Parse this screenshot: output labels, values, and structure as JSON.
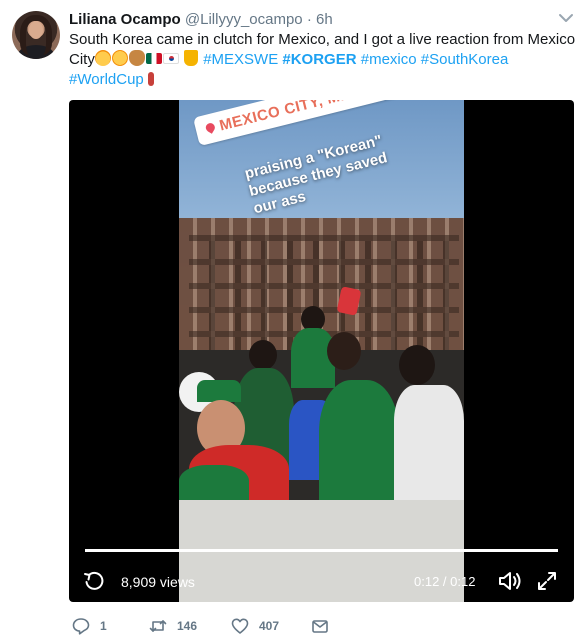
{
  "author": {
    "name": "Liliana Ocampo",
    "handle": "@Lillyyy_ocampo",
    "separator": "·",
    "time": "6h"
  },
  "tweet": {
    "line1": "South Korea came in clutch for Mexico, and I got a live reaction from Mexico",
    "line2_prefix": "City",
    "emojis": [
      "loudly-crying-face",
      "tears-of-joy-face",
      "clapping-hands",
      "mexico-flag",
      "south-korea-flag",
      "trophy"
    ],
    "hashtags_line2": [
      "#MEXSWE",
      "#KORGER",
      "#mexico",
      "#SouthKorea"
    ],
    "hashtags_line3": [
      "#WorldCup"
    ],
    "line3_emoji": "microphone"
  },
  "video": {
    "location_sticker": "MEXICO CITY, MEXICO",
    "caption": "praising a \"Korean\" because they saved our ass",
    "views": "8,909 views",
    "time": "0:12 / 0:12",
    "progress": 1.0
  },
  "actions": {
    "replies": "1",
    "retweets": "146",
    "likes": "407"
  },
  "colors": {
    "link": "#1da1f2",
    "muted": "#657786",
    "text": "#14171a"
  }
}
